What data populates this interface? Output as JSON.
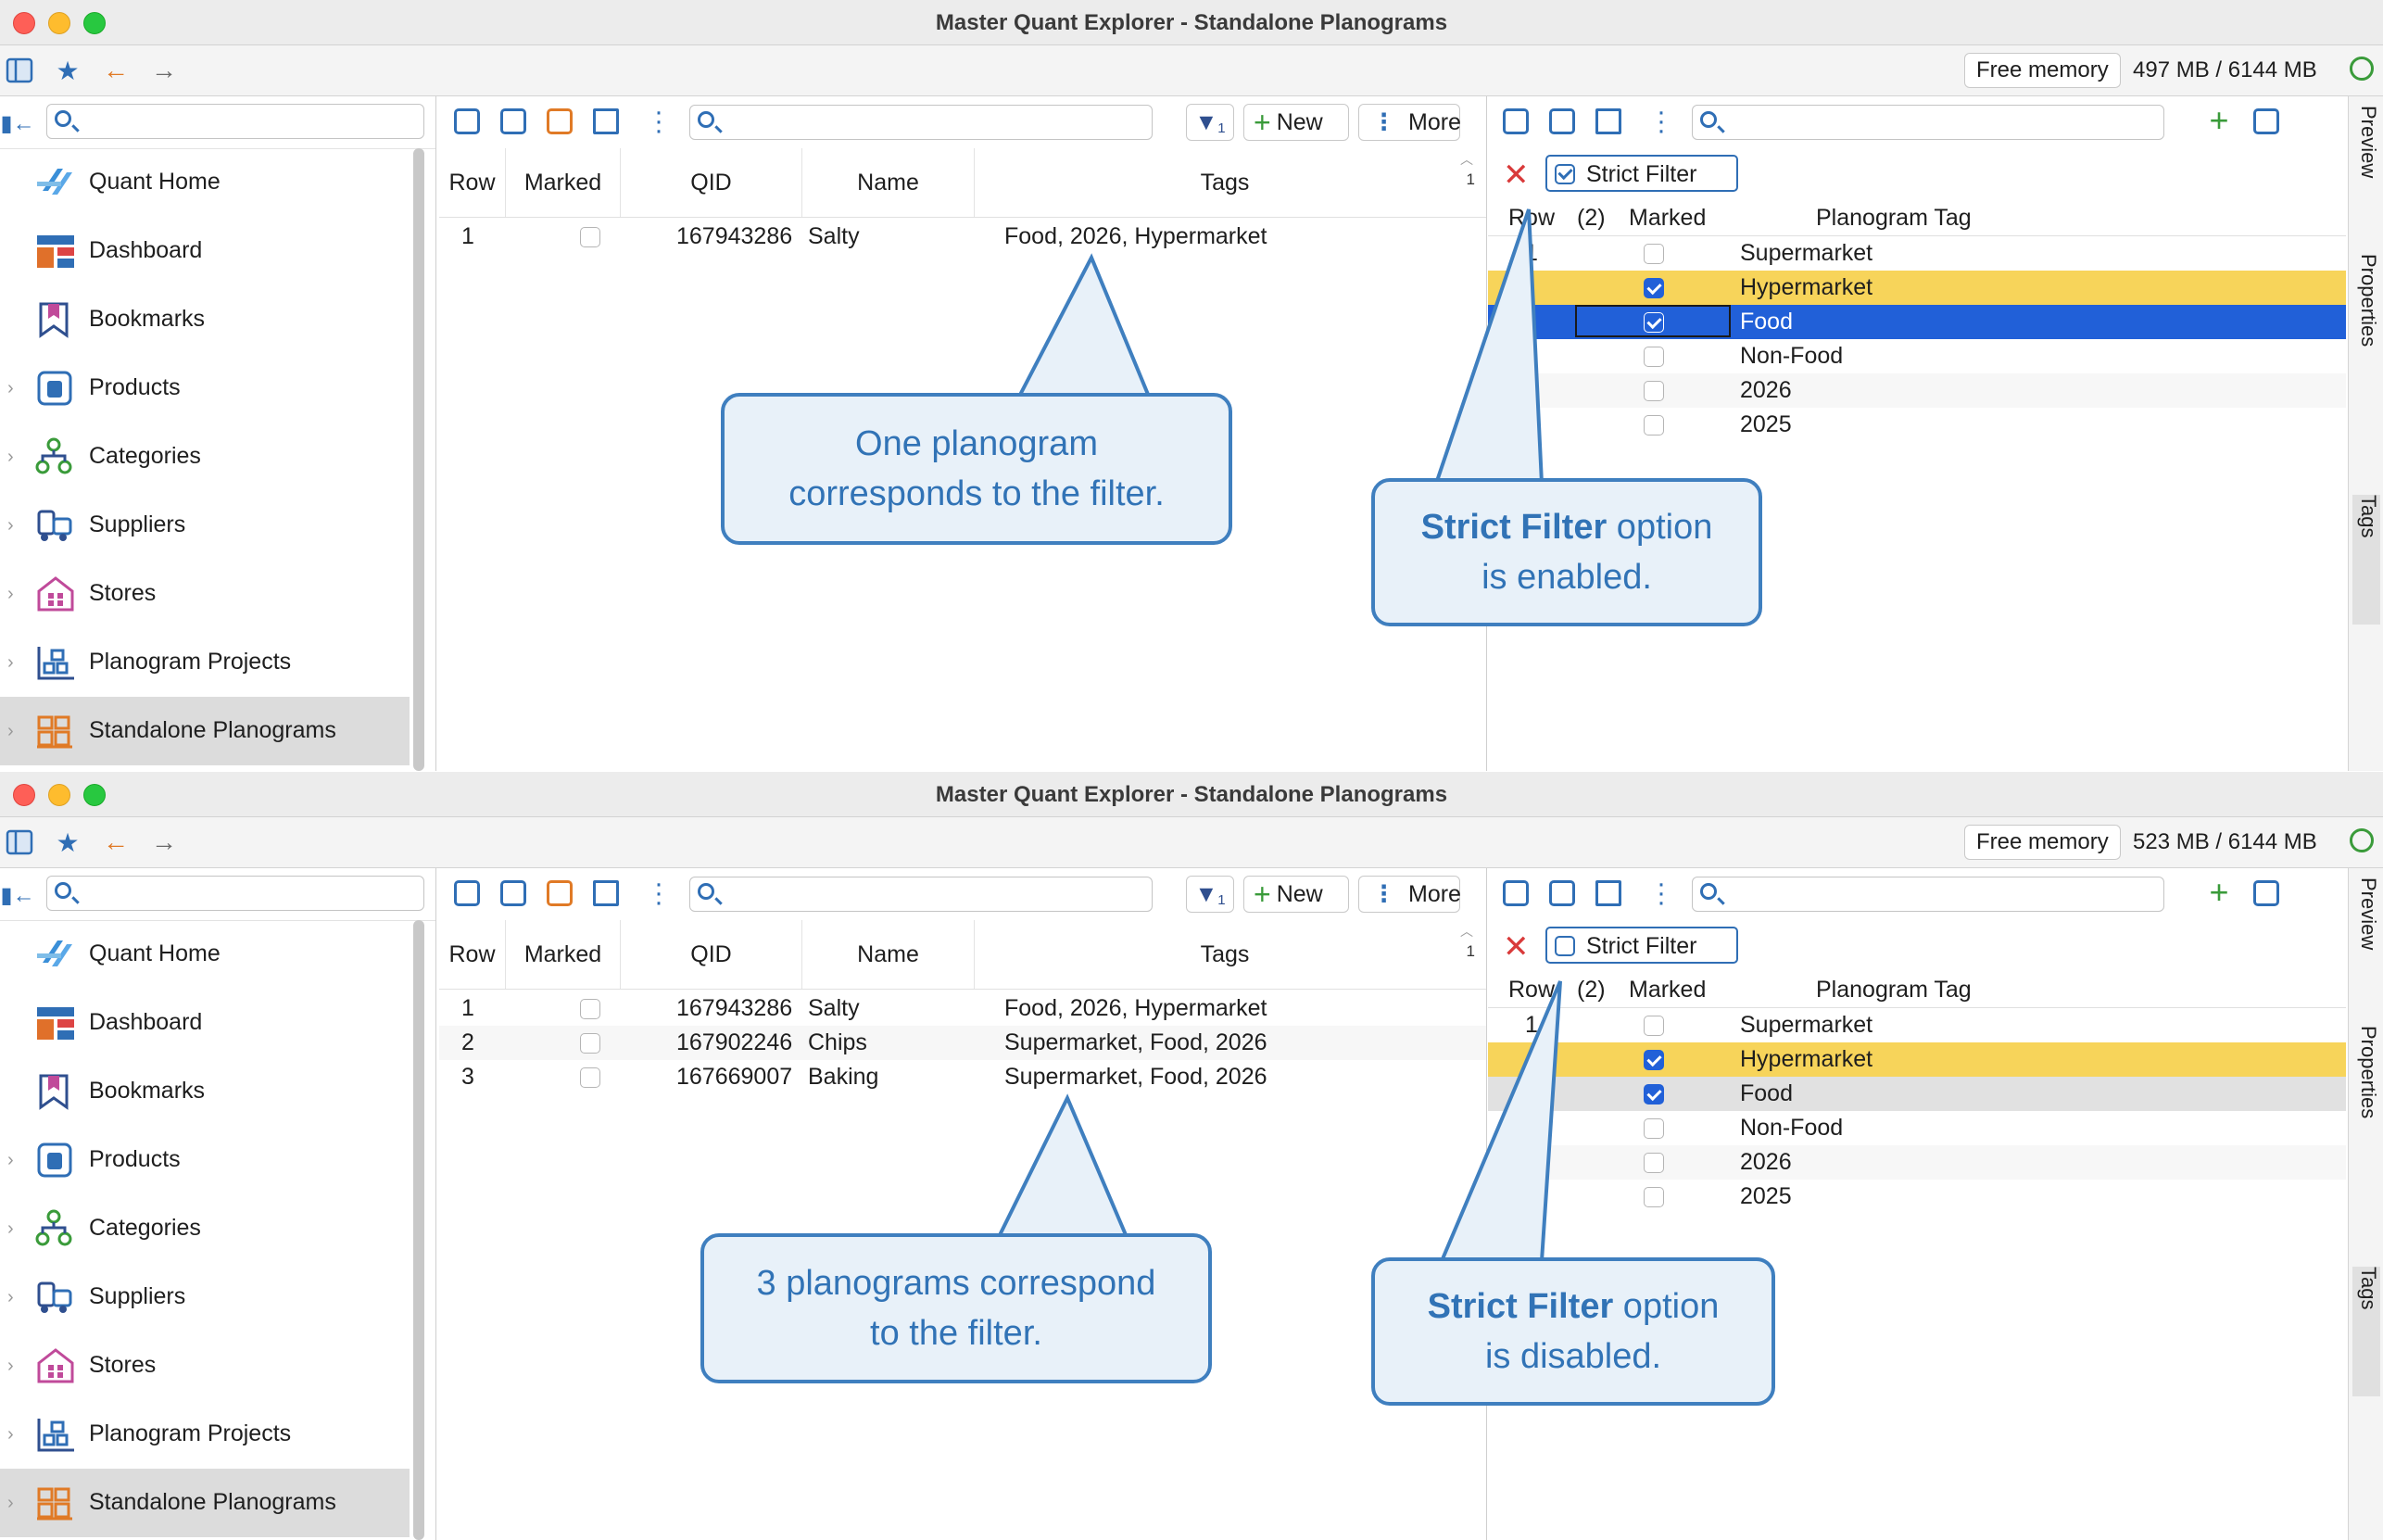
{
  "windows": [
    {
      "title": "Master Quant Explorer - Standalone Planograms",
      "free_memory_label": "Free memory",
      "free_memory_value": "497 MB / 6144 MB",
      "nav_items": [
        "Quant Home",
        "Dashboard",
        "Bookmarks",
        "Products",
        "Categories",
        "Suppliers",
        "Stores",
        "Planogram Projects",
        "Standalone Planograms"
      ],
      "center": {
        "new_label": "New",
        "more_label": "More",
        "filter_badge": "1",
        "columns": [
          "Row",
          "Marked",
          "QID",
          "Name",
          "Tags"
        ],
        "sort_number": "1",
        "rows": [
          {
            "row": "1",
            "qid": "167943286",
            "name": "Salty",
            "tags": "Food, 2026, Hypermarket"
          }
        ]
      },
      "tags_panel": {
        "strict_filter_label": "Strict Filter",
        "strict_filter_checked": true,
        "columns": [
          "Row",
          "(2)",
          "Marked",
          "Planogram Tag"
        ],
        "first_row_num": "1",
        "rows": [
          {
            "tag": "Supermarket",
            "marked": false,
            "style": "plain"
          },
          {
            "tag": "Hypermarket",
            "marked": true,
            "style": "yellow"
          },
          {
            "tag": "Food",
            "marked": true,
            "style": "blue"
          },
          {
            "tag": "Non-Food",
            "marked": false,
            "style": "plain"
          },
          {
            "tag": "2026",
            "marked": false,
            "style": "plain"
          },
          {
            "tag": "2025",
            "marked": false,
            "style": "plain"
          }
        ]
      },
      "side_tabs": [
        "Preview",
        "Properties",
        "Tags"
      ],
      "callout_center": {
        "line1": "One planogram",
        "line2": "corresponds to the filter."
      },
      "callout_right": {
        "bold": "Strict Filter",
        "rest": " option",
        "line2": "is enabled."
      }
    },
    {
      "title": "Master Quant Explorer - Standalone Planograms",
      "free_memory_label": "Free memory",
      "free_memory_value": "523 MB / 6144 MB",
      "nav_items": [
        "Quant Home",
        "Dashboard",
        "Bookmarks",
        "Products",
        "Categories",
        "Suppliers",
        "Stores",
        "Planogram Projects",
        "Standalone Planograms"
      ],
      "center": {
        "new_label": "New",
        "more_label": "More",
        "filter_badge": "1",
        "columns": [
          "Row",
          "Marked",
          "QID",
          "Name",
          "Tags"
        ],
        "sort_number": "1",
        "rows": [
          {
            "row": "1",
            "qid": "167943286",
            "name": "Salty",
            "tags": "Food, 2026, Hypermarket"
          },
          {
            "row": "2",
            "qid": "167902246",
            "name": "Chips",
            "tags": "Supermarket, Food, 2026"
          },
          {
            "row": "3",
            "qid": "167669007",
            "name": "Baking",
            "tags": "Supermarket, Food, 2026"
          }
        ]
      },
      "tags_panel": {
        "strict_filter_label": "Strict Filter",
        "strict_filter_checked": false,
        "columns": [
          "Row",
          "(2)",
          "Marked",
          "Planogram Tag"
        ],
        "first_row_num": "1",
        "rows": [
          {
            "tag": "Supermarket",
            "marked": false,
            "style": "plain"
          },
          {
            "tag": "Hypermarket",
            "marked": true,
            "style": "yellow"
          },
          {
            "tag": "Food",
            "marked": true,
            "style": "grey"
          },
          {
            "tag": "Non-Food",
            "marked": false,
            "style": "plain"
          },
          {
            "tag": "2026",
            "marked": false,
            "style": "plain"
          },
          {
            "tag": "2025",
            "marked": false,
            "style": "plain"
          }
        ]
      },
      "side_tabs": [
        "Preview",
        "Properties",
        "Tags"
      ],
      "callout_center": {
        "line1": "3 planograms correspond",
        "line2": "to the filter."
      },
      "callout_right": {
        "bold": "Strict Filter",
        "rest": " option",
        "line2": "is disabled."
      }
    }
  ],
  "colors": {
    "accent": "#2f6eb5",
    "selected_row": "#2160d8",
    "marked_row": "#f7d45a",
    "callout_fill": "#e8f1f9",
    "callout_text": "#3173b6"
  }
}
